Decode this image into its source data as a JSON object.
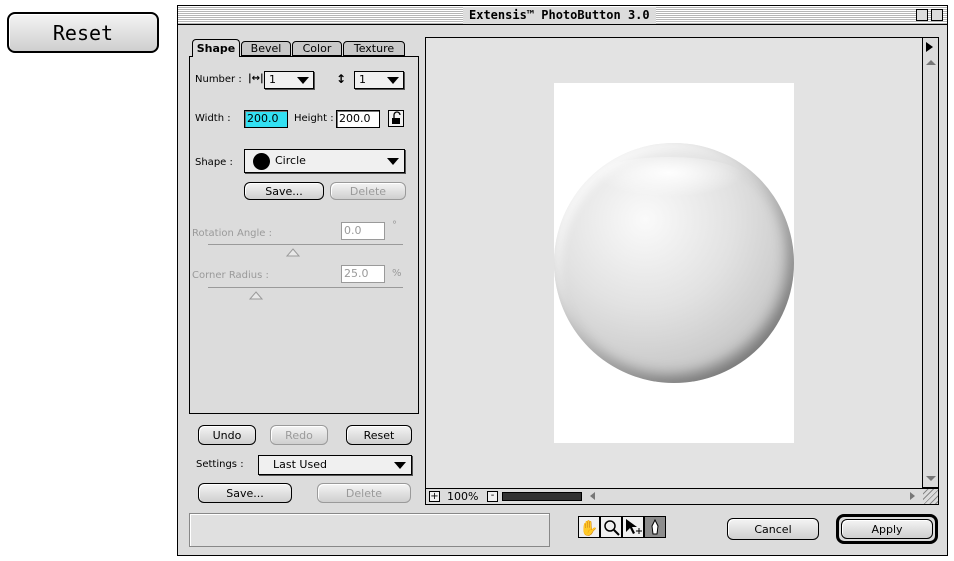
{
  "standalone_reset_label": "Reset",
  "window": {
    "title": "Extensis™ PhotoButton 3.0"
  },
  "tabs": [
    "Shape",
    "Bevel",
    "Color",
    "Texture"
  ],
  "shape_panel": {
    "number_label": "Number :",
    "h_count": "1",
    "v_count": "1",
    "width_label": "Width :",
    "width_value": "200.0",
    "height_label": "Height :",
    "height_value": "200.0",
    "shape_label": "Shape :",
    "shape_value": "Circle",
    "save_label": "Save...",
    "delete_label": "Delete",
    "rotation_label": "Rotation Angle :",
    "rotation_value": "0.0",
    "rotation_unit": "°",
    "corner_label": "Corner Radius :",
    "corner_value": "25.0",
    "corner_unit": "%"
  },
  "history": {
    "undo": "Undo",
    "redo": "Redo",
    "reset": "Reset"
  },
  "settings": {
    "label": "Settings :",
    "value": "Last Used",
    "save": "Save...",
    "delete": "Delete"
  },
  "preview": {
    "zoom": "100%"
  },
  "footer": {
    "cancel": "Cancel",
    "apply": "Apply"
  },
  "icons": [
    "hand-icon",
    "magnifier-icon",
    "move-arrow-icon",
    "eyedropper-icon",
    "lock-icon",
    "zoom-in-icon",
    "zoom-out-icon"
  ]
}
